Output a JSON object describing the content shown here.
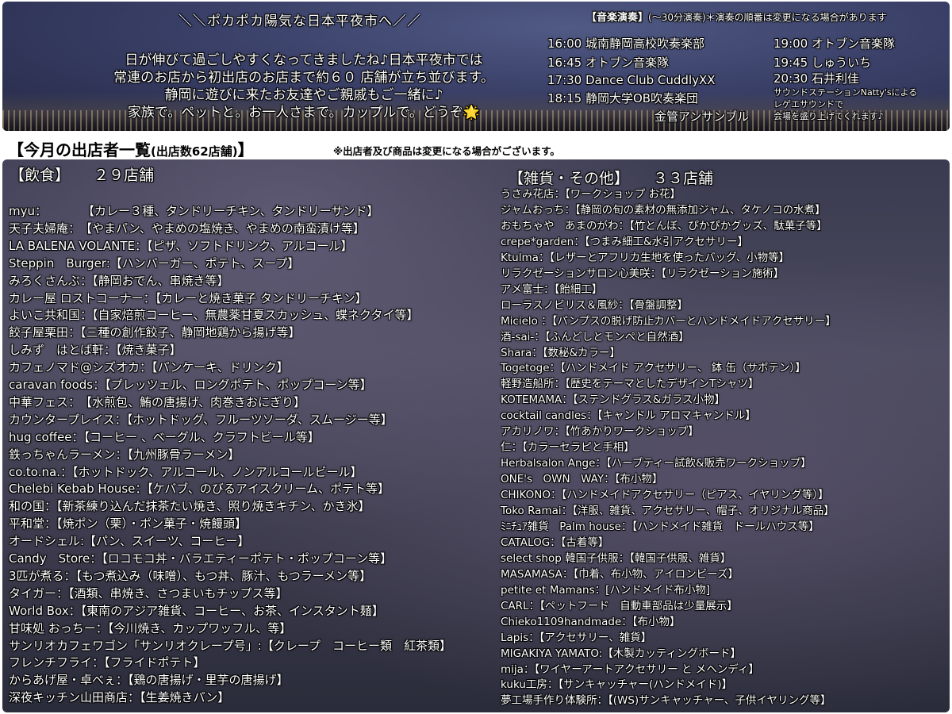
{
  "banner": "＼＼ポカポカ陽気な日本平夜市へ／／",
  "intro": [
    "日が伸びて過ごしやすくなってきましたね♪日本平夜市では",
    "常連のお店から初出店のお店まで約６０ 店舗が立ち並びます。",
    "静岡に遊びに来たお友達やご親戚もご一緒に♪",
    "家族で。ペットと。お一人さまで。カップルで。どうぞ"
  ],
  "intro_star": "🌟",
  "music": {
    "title": "【音楽演奏】",
    "subtitle": "(〜30分演奏)＊演奏の順番は変更になる場合があります",
    "left": [
      "16:00  城南静岡高校吹奏楽部",
      "16:45  オトブン音楽隊",
      "17:30 Dance Club CuddlyXX",
      "18:15 静岡大学OB吹奏楽団",
      "金管アンサンブル"
    ],
    "right": [
      "19:00 オトブン音楽隊",
      "19:45 しゅういち",
      "20:30 石井利佳"
    ],
    "right_note": [
      "サウンドステーションNatty'sによる",
      "レゲエサウンドで",
      "会場を盛り上げてくれます♪"
    ]
  },
  "list": {
    "title": "【今月の出店者一覧",
    "count": "(出店数62店舗)",
    "title_end": "】",
    "note": "※出店者及び商品は変更になる場合がございます。"
  },
  "food": {
    "heading": "【飲食】",
    "count": "２９店舗",
    "items": [
      "myu：　　　　【カレー３種、タンドリーチキン、タンドリーサンド】",
      "天子夫婦庵：　【やまパン、やまめの塩焼き、やまめの南蛮漬け等】",
      "LA BALENA VOLANTE：【ピザ、ソフトドリンク、アルコール】",
      "Steppin　Burger:【ハンバーガー、ポテト、スープ】",
      "みろくさんぶ：【静岡おでん、串焼き等】",
      "カレー屋 ロストコーナー：【カレーと焼き菓子 タンドリーチキン】",
      "よいこ共和国：【自家焙煎コーヒー、無農薬甘夏スカッシュ、蝶ネクタイ等】",
      "餃子屋栗田：【三種の創作餃子、静岡地鶏から揚げ等】",
      "しみず　はとば軒：【焼き菓子】",
      "カフェノマド@シズオカ：【パンケーキ、ドリンク】",
      "caravan foods：【プレッツェル、ロングポテト、ポップコーン等】",
      "中華フェス：　【水煎包、鮪の唐揚げ、肉巻きおにぎり】",
      "カウンタープレイス：【ホットドッグ、フルーツソーダ、スムージー等】",
      "hug coffee：【コーヒー 、ベーグル、クラフトビール等】",
      "鉄っちゃんラーメン：【九州豚骨ラーメン】",
      "co.to.na.：【ホットドック、アルコール、ノンアルコールビール】",
      "Chelebi Kebab House：【ケバブ、のびるアイスクリーム、ポテト等】",
      "和の国：【新茶練り込んだ抹茶たい焼き、照り焼きキチン、かき氷】",
      "平和堂：【焼ポン（栗）・ポン菓子・焼饅頭】",
      "オードシェル:【パン、スイーツ、コーヒー】",
      "Candy　Store：【ロコモコ丼・バラエティーポテト・ポップコーン等】",
      "3匹が煮る：【もつ煮込み（味噌）、もつ丼、豚汁、もつラーメン等】",
      "タイガー：【酒類、串焼き、さつまいもチップス等】",
      "World Box：【東南のアジア雑貨、コーヒー、お茶、インスタント麺】",
      "甘味処 おっちー：【今川焼き、カップワッフル、等】",
      "サンリオカフェワゴン「サンリオクレープ号」:【クレープ　コーヒー類　紅茶類】",
      "フレンチフライ：【フライドポテト】",
      "からあげ屋・卓べぇ：【鶏の唐揚げ・里芋の唐揚げ】",
      "深夜キッチン山田商店：【生姜焼きパン】"
    ]
  },
  "goods": {
    "heading": "【雑貨・その他】",
    "count": "３３店舗",
    "items": [
      "うさみ花店：【ワークショップ お花】",
      "ジャムおっち：【静岡の旬の素材の無添加ジャム、タケノコの水煮】",
      "おもちゃや　あまのがわ：【竹とんぼ、ぴかぴかグッズ、駄菓子等】",
      "crepe*garden：【つまみ細工&水引アクセサリー】",
      "Ktulma：【レザーとアフリカ生地を使ったバッグ、小物等】",
      "リラクゼーションサロン心美咲：【リラクゼーション施術】",
      "アメ富士：【飴細工】",
      "ローラスノビリス＆風紗：【骨盤調整】",
      "Micielo ：【パンプスの脱げ防止カバーとハンドメイドアクセサリー】",
      "酒-sai-：【ふんどしとモンペと自然酒】",
      "Shara：【数秘&カラー】",
      "Togetoge：【ハンドメイド アクセサリー、 鉢 缶（サボテン）】",
      "軽野造船所：【歴史をテーマとしたデザインTシャツ】",
      "KOTEMAMA：【ステンドグラス&ガラス小物】",
      "cocktail candles：【キャンドル アロマキャンドル】",
      "アカリノワ：【竹あかりワークショップ】",
      "仁：【カラーセラピと手相】",
      "Herbalsalon Ange：【ハーブティー試飲&販売ワークショップ】",
      "ONE's　OWN　WAY：【布小物】",
      "CHIKONO：【ハンドメイドアクセサリー（ピアス、イヤリング等）】",
      "Toko Ramai：【洋服、雑貨、アクセサリー、帽子、オリジナル商品】",
      "ﾐﾆﾁｭｱ雑貨　Palm house：【ハンドメイド雑貨　ドールハウス等】",
      "CATALOG：【古着等】",
      "select shop 韓国子供服：【韓国子供服、雑貨】",
      "MASAMASA：【巾着、布小物、アイロンビーズ】",
      "petite et Mamans：[ハンドメイド布小物]",
      "CARL：【ペットフード　自動車部品は少量展示】",
      "Chieko1109handmade：【布小物】",
      "Lapis：【アクセサリー、雑貨】",
      "MIGAKIYA YAMATO:【木製カッティングボード】",
      "mija：【ワイヤーアートアクセサリー と メヘンディ】",
      "kuku工房：【サンキャッチャー(ハンドメイド)】",
      "夢工場手作り体験所：【(WS)サンキャッチャー、子供イヤリング等】"
    ]
  }
}
